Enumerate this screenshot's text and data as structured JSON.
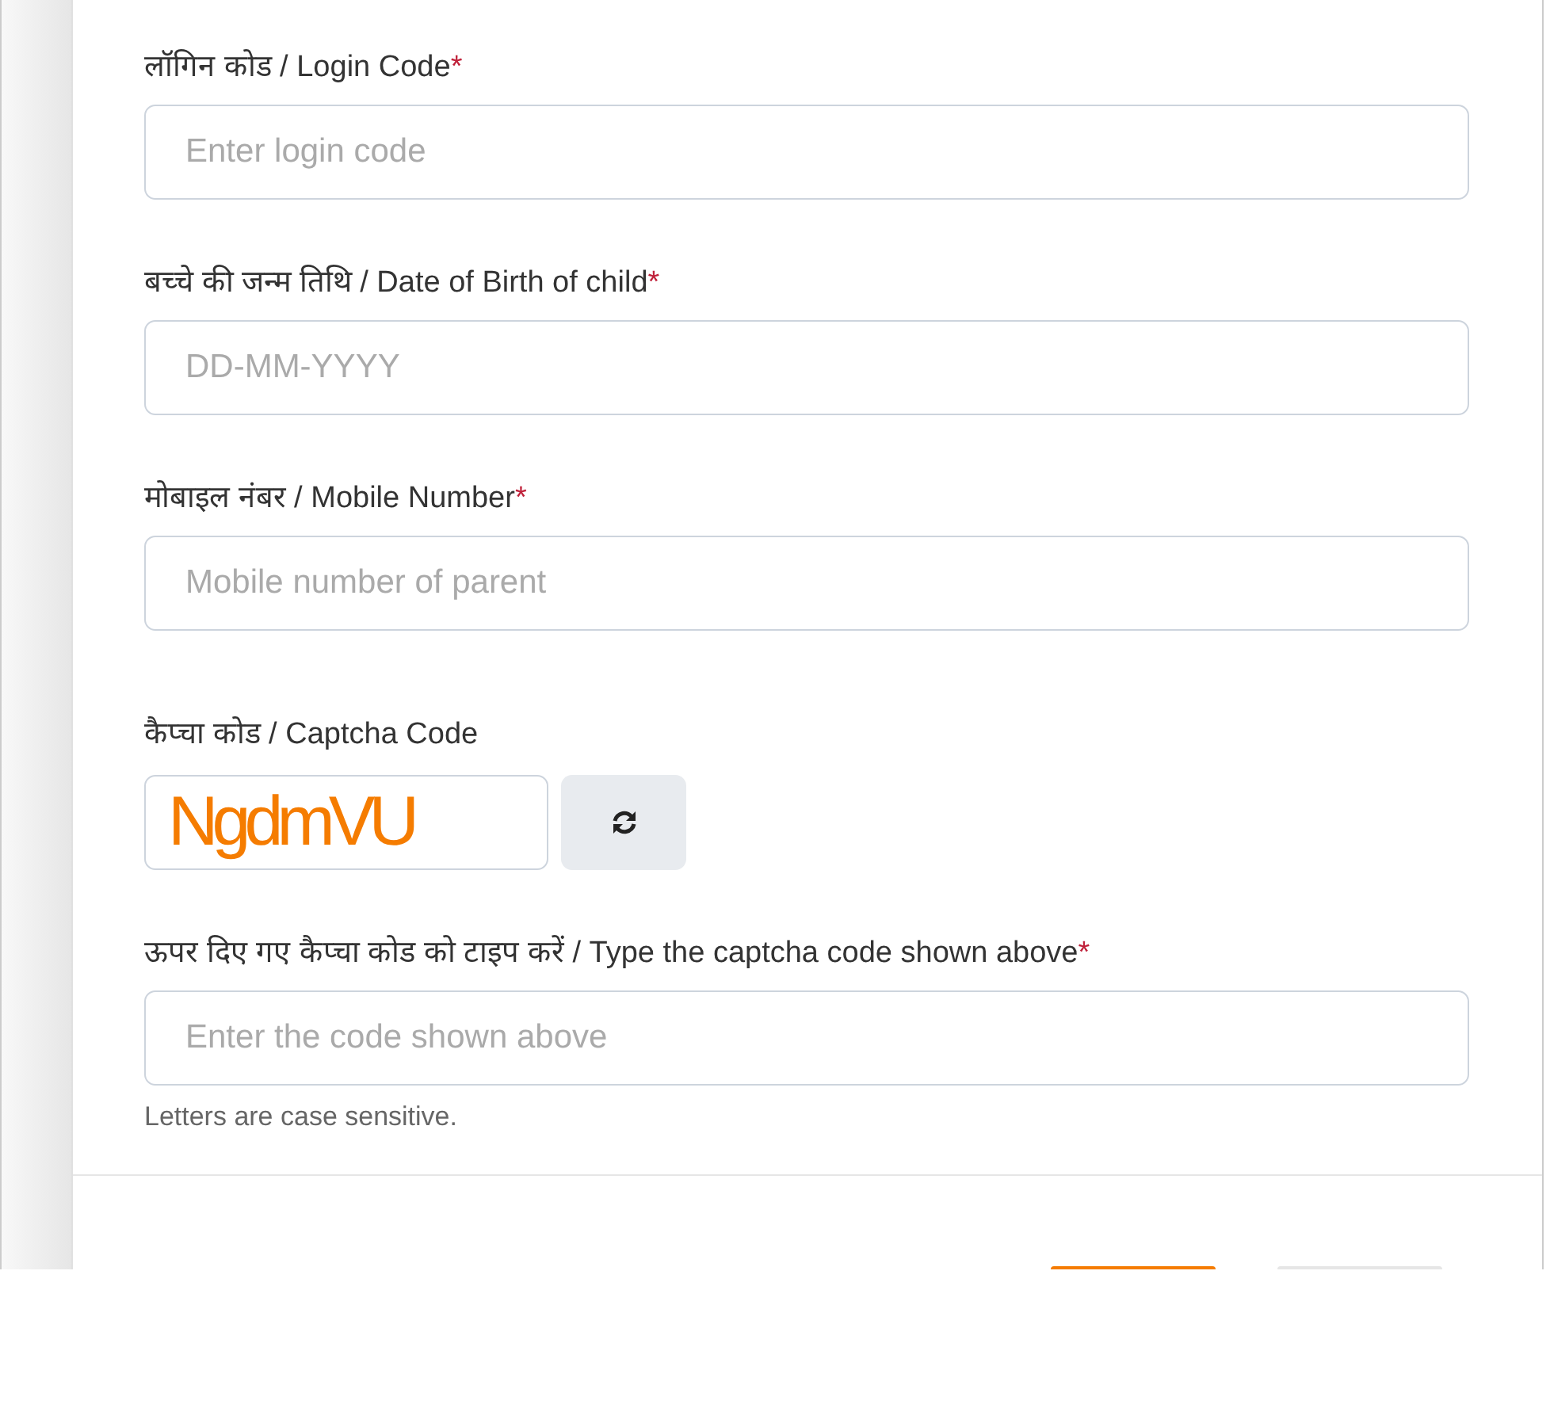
{
  "fields": [
    {
      "label": "लॉगिन कोड / Login Code",
      "required": true,
      "placeholder": "Enter login code"
    },
    {
      "label": "बच्चे की जन्म तिथि / Date of Birth of child",
      "required": true,
      "placeholder": "DD-MM-YYYY"
    },
    {
      "label": "मोबाइल नंबर / Mobile Number",
      "required": true,
      "placeholder": "Mobile number of parent"
    }
  ],
  "captcha": {
    "label": "कैप्चा कोड / Captcha Code",
    "code": "NgdmVU"
  },
  "captcha_input": {
    "label": "ऊपर दिए गए कैप्चा कोड को टाइप करें / Type the captcha code shown above",
    "required": true,
    "placeholder": "Enter the code shown above",
    "help": "Letters are case sensitive."
  },
  "required_mark": "*"
}
